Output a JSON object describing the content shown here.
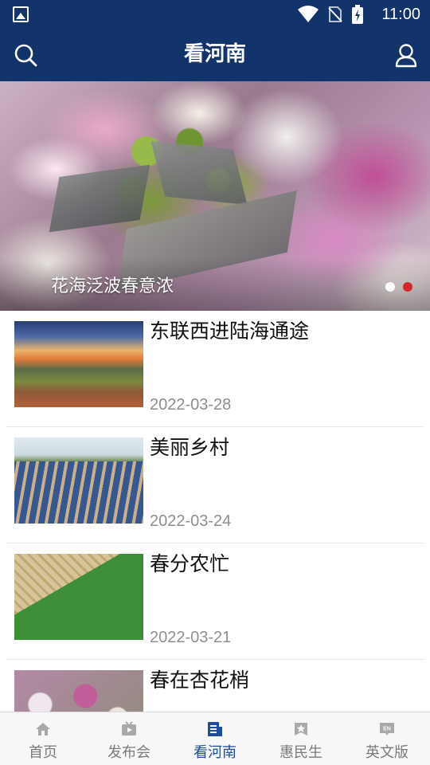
{
  "status_bar": {
    "time": "11:00",
    "icons": [
      "gallery-icon",
      "wifi-icon",
      "no-sim-icon",
      "battery-charging-icon"
    ]
  },
  "header": {
    "title": "看河南",
    "icons": [
      "search-icon",
      "user-icon"
    ]
  },
  "banner": {
    "caption": "花海泛波春意浓",
    "dots_total": 2,
    "active_dot": 2,
    "dot_colors": {
      "inactive": "#ffffff",
      "active": "#d22a2a"
    }
  },
  "news": [
    {
      "headline": "东联西进陆海通途",
      "date": "2022-03-28"
    },
    {
      "headline": "美丽乡村",
      "date": "2022-03-24"
    },
    {
      "headline": "春分农忙",
      "date": "2022-03-21"
    },
    {
      "headline": "春在杏花梢",
      "date": ""
    }
  ],
  "tabs": [
    {
      "label": "首页",
      "icon": "home-icon",
      "active": false
    },
    {
      "label": "发布会",
      "icon": "video-icon",
      "active": false
    },
    {
      "label": "看河南",
      "icon": "article-icon",
      "active": true
    },
    {
      "label": "惠民生",
      "icon": "star-badge-icon",
      "active": false
    },
    {
      "label": "英文版",
      "icon": "en-icon",
      "active": false
    }
  ],
  "colors": {
    "brand": "#13346a",
    "tab_active": "#1f4d9b",
    "tab_inactive": "#7a7a7a",
    "date_text": "#8e8e8e"
  }
}
